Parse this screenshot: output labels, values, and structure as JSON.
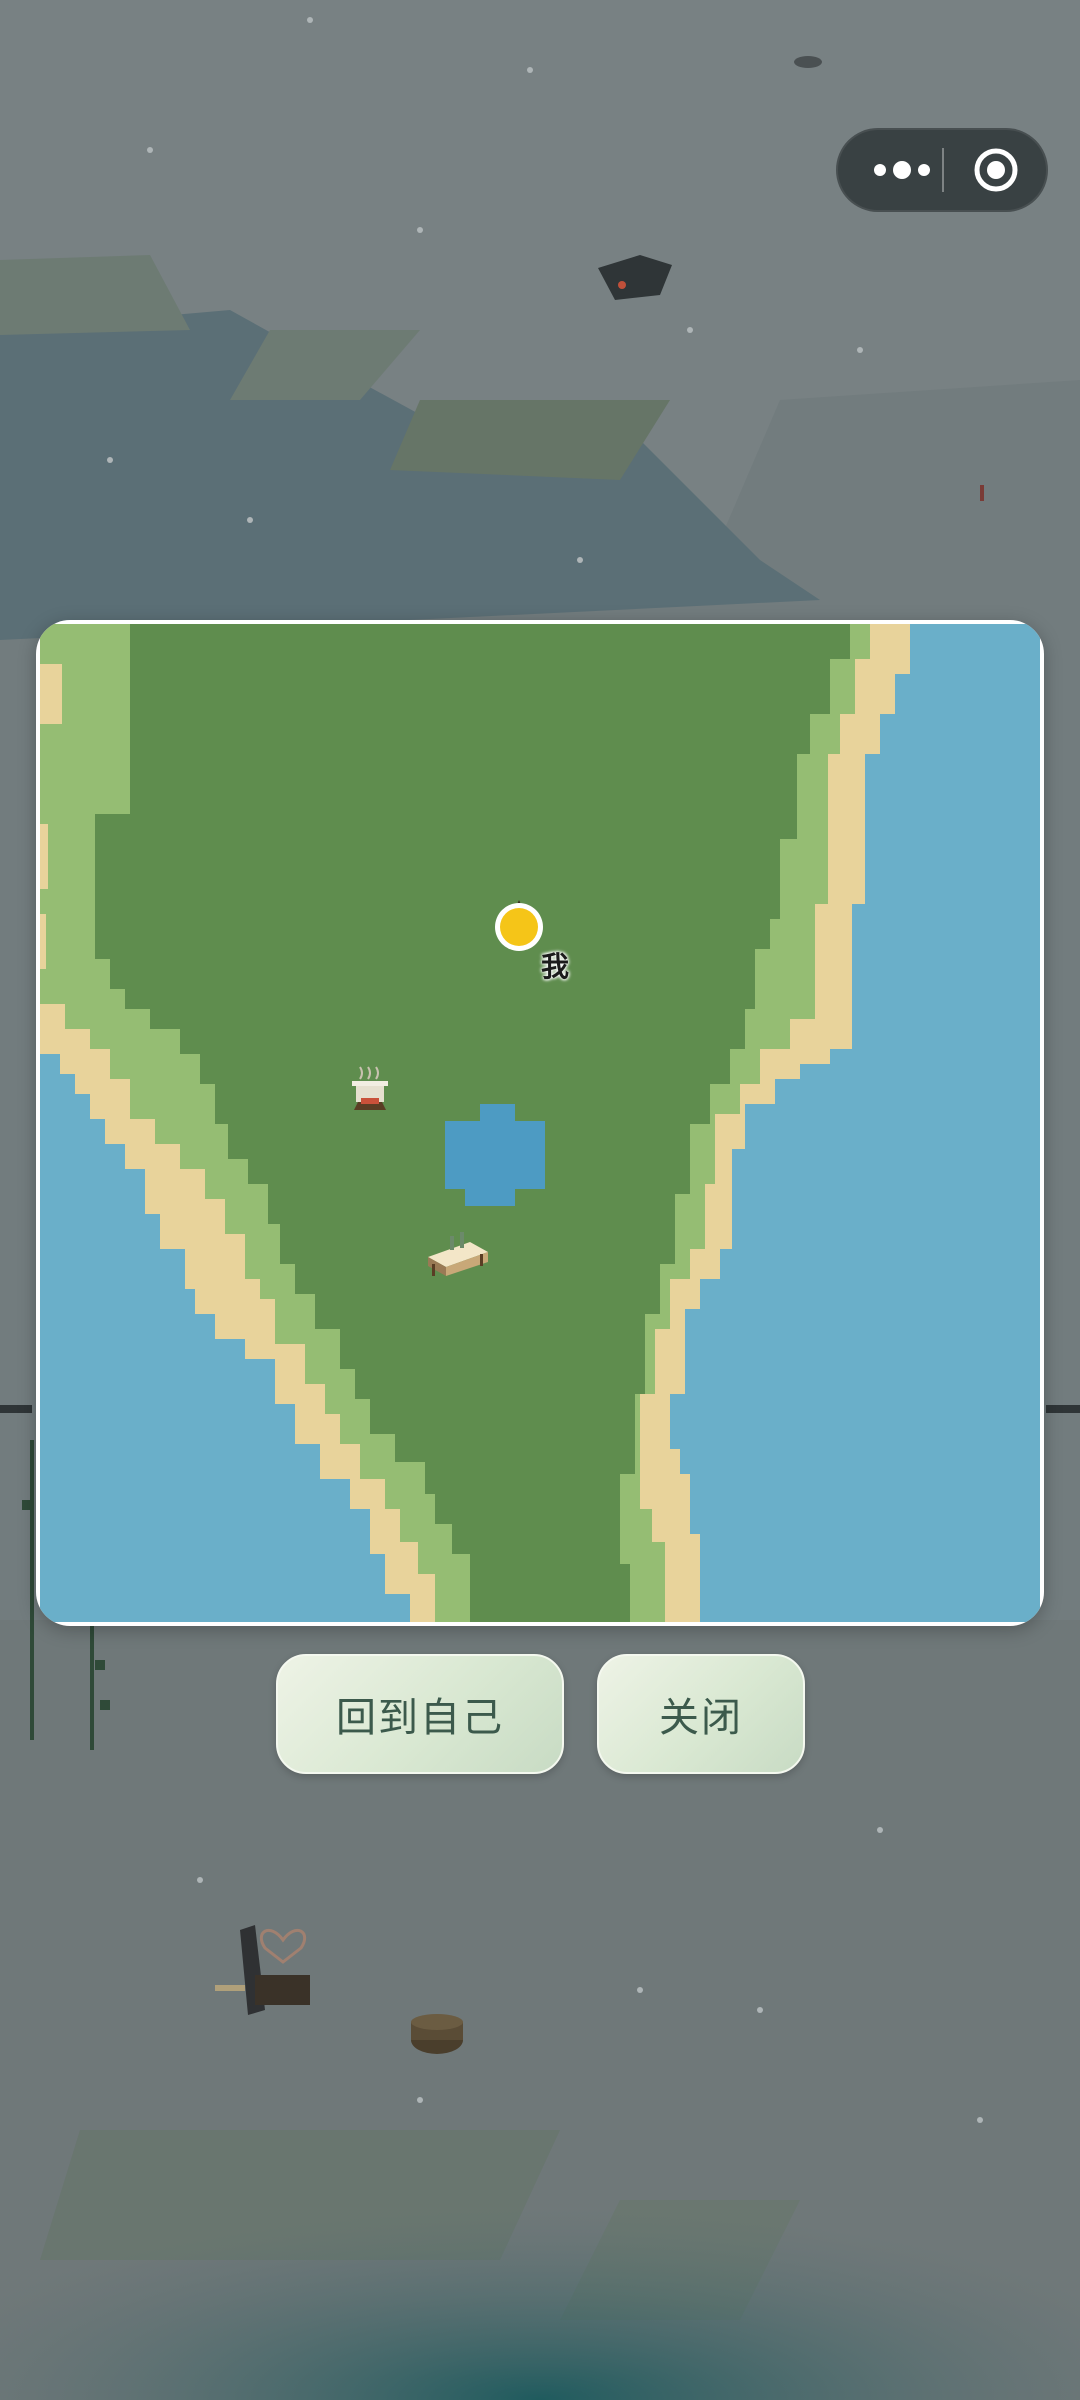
{
  "top_capsule": {
    "more_icon": "more-dots-icon",
    "target_icon": "target-icon"
  },
  "map": {
    "player_label": "我",
    "markers": [
      "cooking-pot-icon",
      "shelter-camp-icon"
    ],
    "colors": {
      "grass_dark": "#5f8d4e",
      "grass_light": "#95bd73",
      "sand": "#e8d39b",
      "water": "#6aafc9",
      "lake": "#4d9bc3",
      "player": "#f5c518"
    }
  },
  "buttons": {
    "home_label": "回到自己",
    "close_label": "关闭"
  },
  "colors": {
    "button_text": "#3c5a4c",
    "scene_background": "#6f7a7c"
  }
}
